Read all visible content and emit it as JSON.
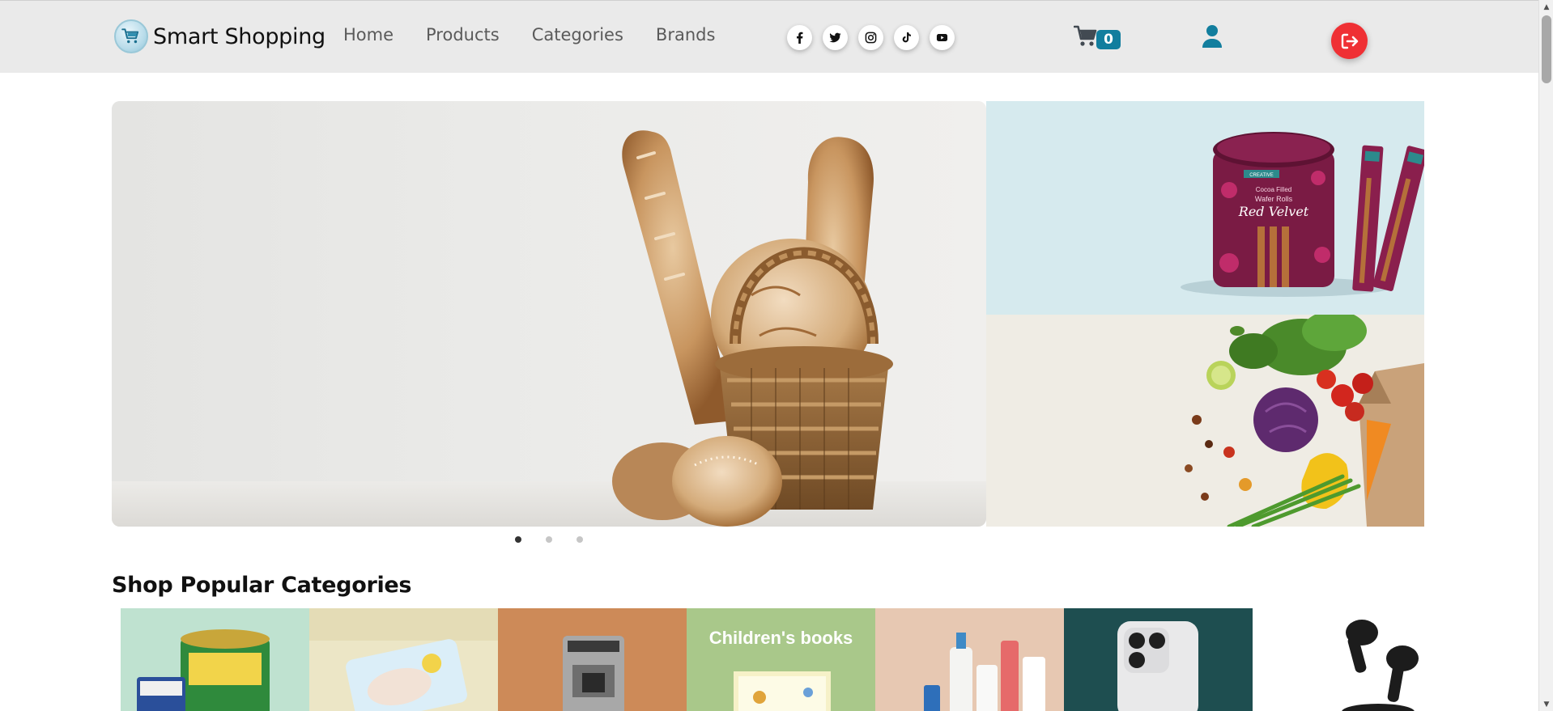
{
  "brand": {
    "name": "Smart Shopping",
    "logo_icon": "shopping-cart-logo-icon"
  },
  "nav": {
    "links": [
      "Home",
      "Products",
      "Categories",
      "Brands"
    ]
  },
  "socials": [
    {
      "name": "facebook",
      "glyph": "f"
    },
    {
      "name": "twitter",
      "glyph": ""
    },
    {
      "name": "instagram",
      "glyph": ""
    },
    {
      "name": "tiktok",
      "glyph": ""
    },
    {
      "name": "youtube",
      "glyph": ""
    }
  ],
  "cart": {
    "count": "0",
    "icon": "cart-icon"
  },
  "user": {
    "icon": "user-icon"
  },
  "logout": {
    "icon": "logout-icon"
  },
  "colors": {
    "accent": "#127e9e",
    "logout": "#ef3034",
    "navbar": "#eaeaea"
  },
  "hero": {
    "slides": 3,
    "active_slide": 1,
    "main_image": "bread-basket",
    "side_top_image": "red-velvet-wafer-rolls",
    "side_top_text": {
      "brand": "CREATIVE",
      "line1": "Cocoa Filled",
      "line2": "Wafer Rolls",
      "line3": "Red Velvet"
    },
    "side_bottom_image": "fresh-vegetables"
  },
  "categories": {
    "title": "Shop Popular Categories",
    "tiles": [
      {
        "name": "milk-formula"
      },
      {
        "name": "baby-diapers"
      },
      {
        "name": "coffee-machine"
      },
      {
        "name": "childrens-books",
        "text": "Children's books"
      },
      {
        "name": "skincare"
      },
      {
        "name": "mobile-phones"
      },
      {
        "name": "earbuds"
      }
    ]
  }
}
